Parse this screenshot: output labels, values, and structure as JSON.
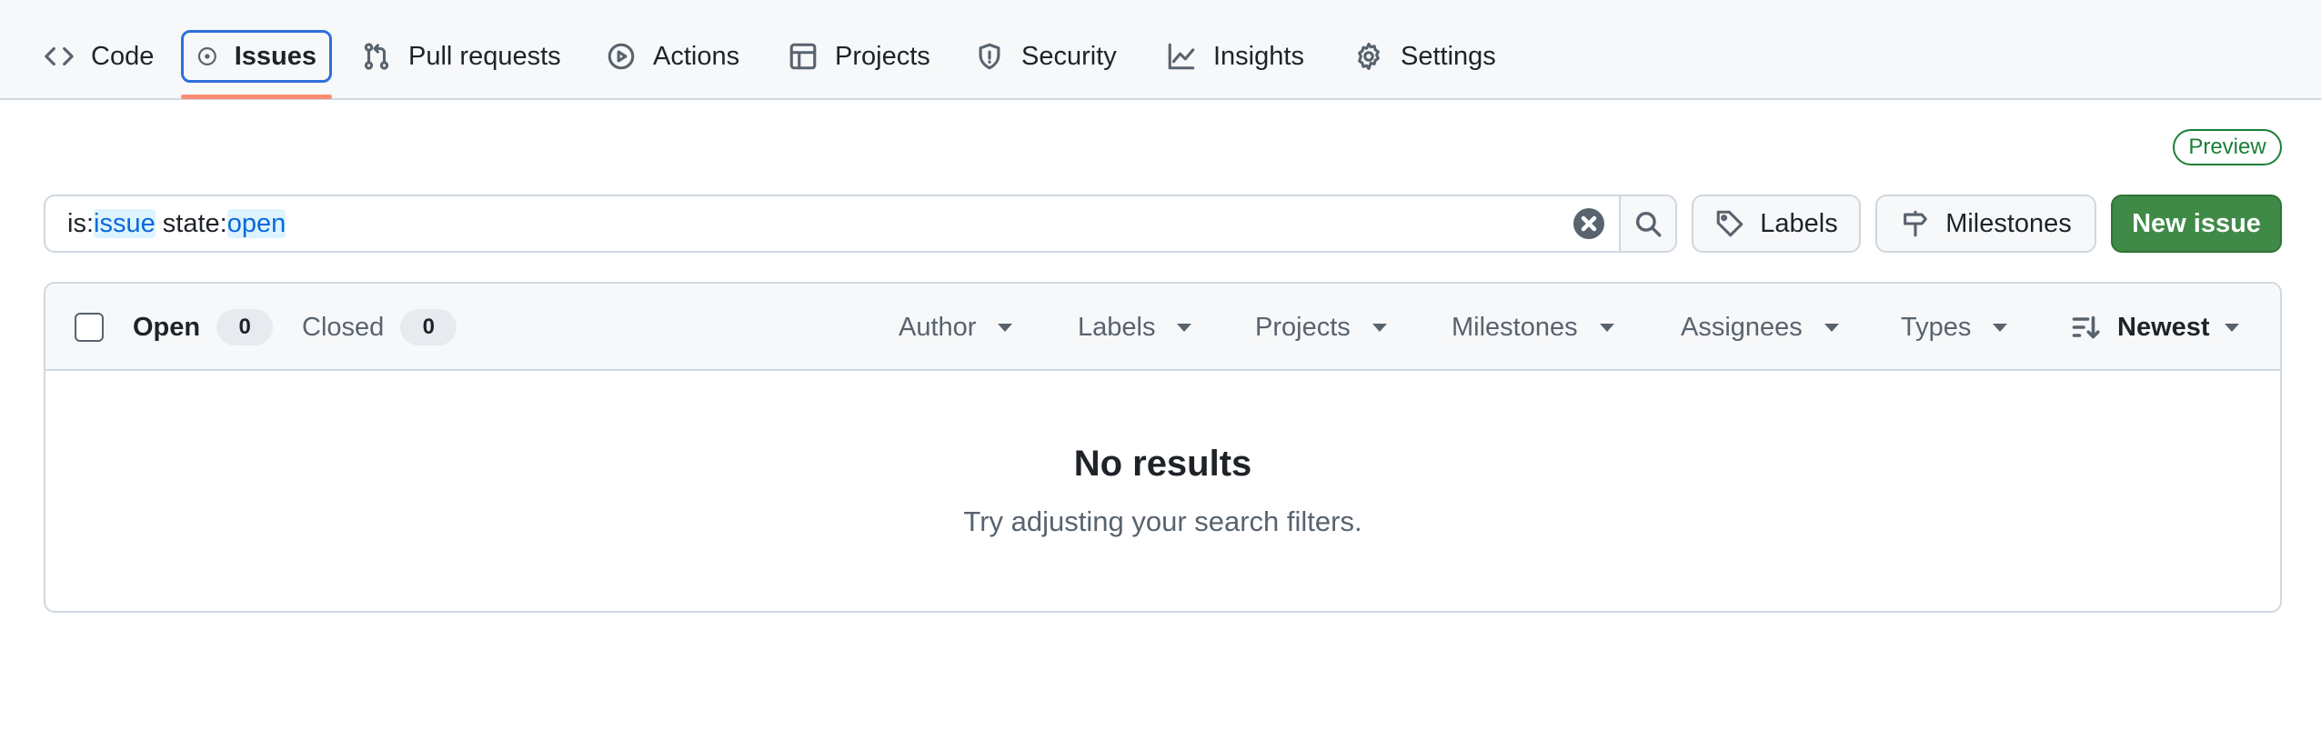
{
  "nav": {
    "tabs": [
      {
        "label": "Code",
        "icon": "code-icon"
      },
      {
        "label": "Issues",
        "icon": "issue-opened-icon",
        "selected": true
      },
      {
        "label": "Pull requests",
        "icon": "git-pull-request-icon"
      },
      {
        "label": "Actions",
        "icon": "play-icon"
      },
      {
        "label": "Projects",
        "icon": "table-icon"
      },
      {
        "label": "Security",
        "icon": "shield-icon"
      },
      {
        "label": "Insights",
        "icon": "graph-icon"
      },
      {
        "label": "Settings",
        "icon": "gear-icon"
      }
    ]
  },
  "badge": {
    "preview": "Preview"
  },
  "search": {
    "parts": [
      "is:",
      "issue",
      " state:",
      "open"
    ]
  },
  "buttons": {
    "labels": "Labels",
    "milestones": "Milestones",
    "new_issue": "New issue"
  },
  "list": {
    "open_label": "Open",
    "open_count": "0",
    "closed_label": "Closed",
    "closed_count": "0",
    "filters": [
      "Author",
      "Labels",
      "Projects",
      "Milestones",
      "Assignees",
      "Types"
    ],
    "sort_label": "Newest"
  },
  "empty": {
    "title": "No results",
    "description": "Try adjusting your search filters."
  },
  "colors": {
    "accent": "#0969da",
    "primary_button": "#3f8a47",
    "selected_tab_border": "#2f6fdb",
    "tab_underline": "#fd8c73"
  }
}
